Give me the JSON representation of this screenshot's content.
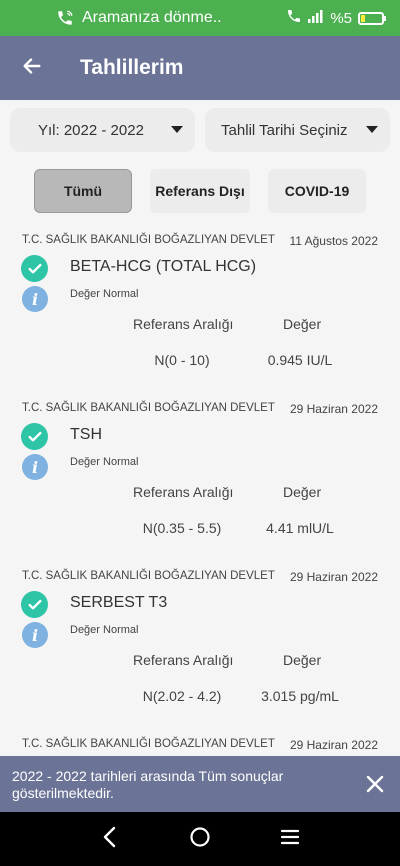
{
  "status_bar": {
    "call_text": "Aramanıza dönme..",
    "battery": "%5",
    "colors": {
      "background": "#4caf50",
      "battery_low": "#ffeb3b"
    }
  },
  "header": {
    "title": "Tahlillerim",
    "back_icon": "arrow-left-icon",
    "color": "#6b7396"
  },
  "filters": {
    "year": "Yıl: 2022 - 2022",
    "date": "Tahlil Tarihi Seçiniz"
  },
  "tabs": [
    {
      "label": "Tümü",
      "active": true
    },
    {
      "label": "Referans Dışı",
      "active": false
    },
    {
      "label": "COVID-19",
      "active": false
    }
  ],
  "labels": {
    "ref_header": "Referans Aralığı",
    "value_header": "Değer"
  },
  "results": [
    {
      "hospital": "T.C. SAĞLIK BAKANLIĞI BOĞAZLIYAN DEVLET",
      "date": "11 Ağustos 2022",
      "name": "BETA-HCG (TOTAL HCG)",
      "status": "Değer Normal",
      "reference": "N(0 - 10)",
      "value": "0.945 IU/L"
    },
    {
      "hospital": "T.C. SAĞLIK BAKANLIĞI BOĞAZLIYAN DEVLET",
      "date": "29 Haziran 2022",
      "name": "TSH",
      "status": "Değer Normal",
      "reference": "N(0.35 - 5.5)",
      "value": "4.41 mlU/L"
    },
    {
      "hospital": "T.C. SAĞLIK BAKANLIĞI BOĞAZLIYAN DEVLET",
      "date": "29 Haziran 2022",
      "name": "SERBEST T3",
      "status": "Değer Normal",
      "reference": "N(2.02 - 4.2)",
      "value": "3.015 pg/mL"
    },
    {
      "hospital": "T.C. SAĞLIK BAKANLIĞI BOĞAZLIYAN DEVLET",
      "date": "29 Haziran 2022"
    }
  ],
  "snackbar": {
    "message": "2022 - 2022 tarihleri arasında Tüm sonuçlar gösterilmektedir."
  },
  "colors": {
    "check": "#2ec4a6",
    "info": "#7fb2e0"
  }
}
